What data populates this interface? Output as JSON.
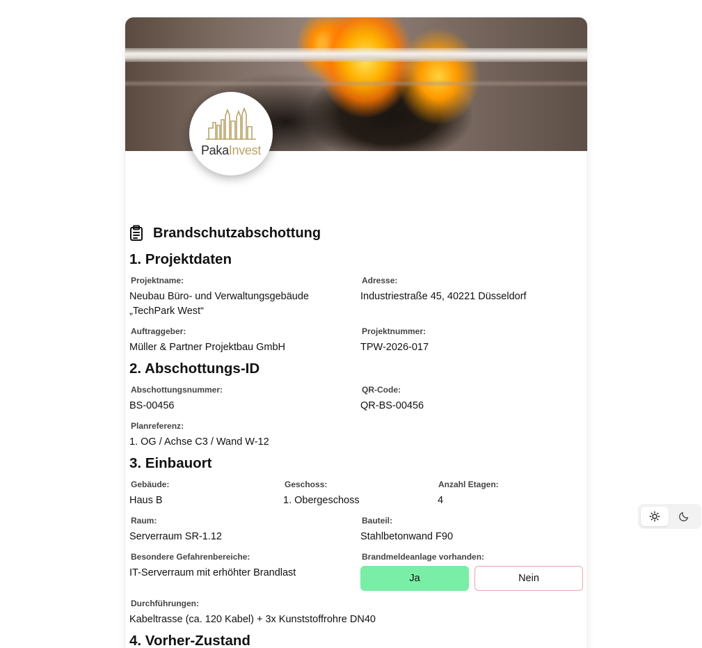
{
  "form": {
    "title": "Brandschutzabschottung",
    "logo": {
      "part1": "Paka",
      "part2": "Invest"
    },
    "sections": {
      "projektdaten": {
        "heading": "1. Projektdaten",
        "projektname_label": "Projektname:",
        "projektname_line1": "Neubau Büro- und Verwaltungsgebäude",
        "projektname_line2": "„TechPark West“",
        "adresse_label": "Adresse:",
        "adresse_value": "Industriestraße 45, 40221 Düsseldorf",
        "auftraggeber_label": "Auftraggeber:",
        "auftraggeber_value": "Müller & Partner Projektbau GmbH",
        "projektnummer_label": "Projektnummer:",
        "projektnummer_value": "TPW-2026-017"
      },
      "abschottung": {
        "heading": "2. Abschottungs-ID",
        "nummer_label": "Abschottungsnummer:",
        "nummer_value": "BS-00456",
        "qr_label": "QR-Code:",
        "qr_value": "QR-BS-00456",
        "plan_label": "Planreferenz:",
        "plan_value": "1. OG / Achse C3 / Wand W-12"
      },
      "einbauort": {
        "heading": "3. Einbauort",
        "gebaeude_label": "Gebäude:",
        "gebaeude_value": "Haus B",
        "geschoss_label": "Geschoss:",
        "geschoss_value": "1. Obergeschoss",
        "etagen_label": "Anzahl Etagen:",
        "etagen_value": "4",
        "raum_label": "Raum:",
        "raum_value": "Serverraum SR-1.12",
        "bauteil_label": "Bauteil:",
        "bauteil_value": "Stahlbetonwand F90",
        "gefahr_label": "Besondere Gefahrenbereiche:",
        "gefahr_value": "IT-Serverraum mit erhöhter Brandlast",
        "bma_label": "Brandmeldeanlage vorhanden:",
        "bma_yes": "Ja",
        "bma_no": "Nein",
        "bma_selected": "Ja",
        "durch_label": "Durchführungen:",
        "durch_value": "Kabeltrasse (ca. 120 Kabel) + 3x Kunststoffrohre DN40"
      },
      "vorher": {
        "heading": "4. Vorher-Zustand"
      }
    }
  },
  "theme_toggle": {
    "selected": "light",
    "icons": [
      "sun-icon",
      "moon-icon"
    ]
  },
  "colors": {
    "yes_button": "#7aeda6",
    "no_button_border": "#e8a8a8",
    "logo_gold": "#b9a36a"
  }
}
